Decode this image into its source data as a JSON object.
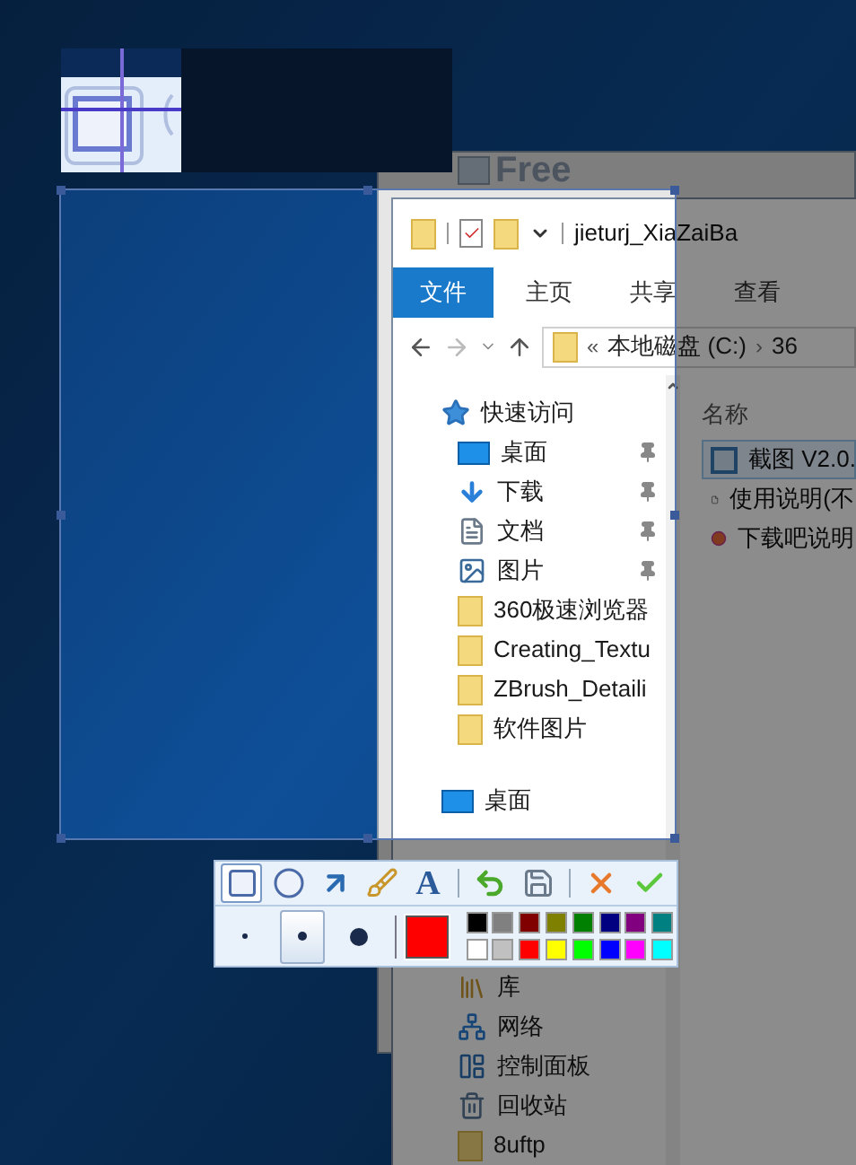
{
  "background_window": {
    "title": "Free"
  },
  "explorer": {
    "title": "jieturj_XiaZaiBa",
    "ribbon_tabs": [
      {
        "label": "文件",
        "selected": true
      },
      {
        "label": "主页",
        "selected": false
      },
      {
        "label": "共享",
        "selected": false
      },
      {
        "label": "查看",
        "selected": false
      }
    ],
    "address": {
      "overflow": "«",
      "segments": [
        "本地磁盘 (C:)",
        "36"
      ],
      "separator": "›"
    },
    "nav": [
      {
        "label": "快速访问",
        "kind": "star",
        "children": [
          {
            "label": "桌面",
            "kind": "desktop",
            "pinned": true
          },
          {
            "label": "下载",
            "kind": "download",
            "pinned": true
          },
          {
            "label": "文档",
            "kind": "document",
            "pinned": true
          },
          {
            "label": "图片",
            "kind": "picture",
            "pinned": true
          },
          {
            "label": "360极速浏览器",
            "kind": "folder",
            "pinned": false
          },
          {
            "label": "Creating_Textu",
            "kind": "folder",
            "pinned": false
          },
          {
            "label": "ZBrush_Detaili",
            "kind": "folder",
            "pinned": false
          },
          {
            "label": "软件图片",
            "kind": "folder",
            "pinned": false
          }
        ]
      },
      {
        "label": "桌面",
        "kind": "desktop",
        "children": [
          {
            "label": "库",
            "kind": "library"
          },
          {
            "label": "网络",
            "kind": "network"
          },
          {
            "label": "控制面板",
            "kind": "control"
          },
          {
            "label": "回收站",
            "kind": "recycle"
          },
          {
            "label": "8uftp",
            "kind": "folder"
          }
        ]
      }
    ],
    "column_header": "名称",
    "files": [
      {
        "name": "截图 V2.0.",
        "kind": "app",
        "selected": true
      },
      {
        "name": "使用说明(不",
        "kind": "text",
        "selected": false
      },
      {
        "name": "下载吧说明",
        "kind": "web",
        "selected": false
      }
    ]
  },
  "toolbar": {
    "tools": [
      {
        "kind": "rectangle",
        "selected": true
      },
      {
        "kind": "ellipse",
        "selected": false
      },
      {
        "kind": "arrow",
        "selected": false
      },
      {
        "kind": "brush",
        "selected": false
      },
      {
        "kind": "text",
        "label": "A",
        "selected": false
      }
    ],
    "actions": [
      {
        "kind": "undo"
      },
      {
        "kind": "save"
      },
      {
        "kind": "cancel"
      },
      {
        "kind": "confirm"
      }
    ],
    "pen_sizes": [
      {
        "selected": false
      },
      {
        "selected": true
      },
      {
        "selected": false
      }
    ],
    "selected_color": {
      "color": "#ff0000"
    },
    "palette": [
      {
        "color": "#000000"
      },
      {
        "color": "#808080"
      },
      {
        "color": "#800000"
      },
      {
        "color": "#808000"
      },
      {
        "color": "#008000"
      },
      {
        "color": "#000080"
      },
      {
        "color": "#800080"
      },
      {
        "color": "#008080"
      },
      {
        "color": "#ffffff"
      },
      {
        "color": "#c0c0c0"
      },
      {
        "color": "#ff0000"
      },
      {
        "color": "#ffff00"
      },
      {
        "color": "#00ff00"
      },
      {
        "color": "#0000ff"
      },
      {
        "color": "#ff00ff"
      },
      {
        "color": "#00ffff"
      }
    ]
  }
}
